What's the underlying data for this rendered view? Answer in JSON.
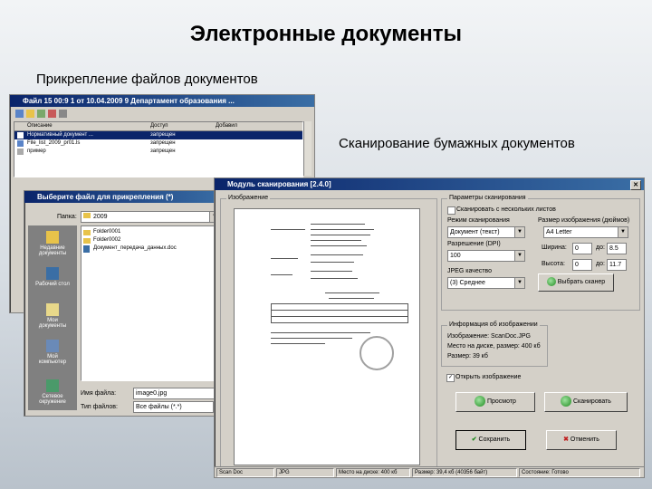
{
  "slide": {
    "title": "Электронные документы",
    "caption_attach": "Прикрепление файлов документов",
    "caption_scan": "Сканирование бумажных документов"
  },
  "main_window": {
    "title": "Файл 15 00:9 1 от 10.04.2009 9 Департамент образования ...",
    "columns": [
      "Описание",
      "Доступ",
      "Добавил"
    ],
    "rows": [
      {
        "desc": "Нормативный документ ...",
        "access": "запрещен"
      },
      {
        "desc": "File_list_2009_pr01.ls",
        "access": "запрещен"
      },
      {
        "desc": "пример",
        "access": "запрещен"
      }
    ]
  },
  "open_dialog": {
    "title": "Выберите файл для прикрепления (*)",
    "lookin_label": "Папка:",
    "lookin_value": "2009",
    "files": [
      "Folder0001",
      "Folder0002",
      "Документ_передача_данных.doc"
    ],
    "places": [
      "Недавние документы",
      "Рабочий стол",
      "Мои документы",
      "Мой компьютер",
      "Сетевое окружение"
    ],
    "filename_label": "Имя файла:",
    "filename_value": "image0.jpg",
    "filetype_label": "Тип файлов:",
    "filetype_value": "Все файлы (*.*)"
  },
  "scan_window": {
    "title": "Модуль сканирования [2.4.0]",
    "image_group": "Изображение",
    "scan_params_group": "Параметры сканирования",
    "multi_page_checkbox": "Сканировать с нескольких листов",
    "mode_label": "Режим сканирования",
    "mode_value": "Документ (текст)",
    "size_label": "Размер изображения (дюймов)",
    "size_value": "A4 Letter",
    "resolution_label": "Разрешение (DPI)",
    "resolution_value": "100",
    "width_label": "Ширина:",
    "width_value": "0",
    "height_label": "Высота:",
    "height_value": "0",
    "to_label": "до:",
    "to_width_value": "8.5",
    "to_height_value": "11.7",
    "jpeg_label": "JPEG качество",
    "jpeg_value": "(3) Среднее",
    "choose_scanner_btn": "Выбрать сканер",
    "info_group": "Информация об изображении",
    "info_line1": "Изображение: ScanDoc.JPG",
    "info_line2": "Место на диске, размер: 400 кб",
    "info_line3": "Размер: 39 кб",
    "view_checkbox": "Открыть изображение",
    "preview_btn": "Просмотр",
    "scan_btn": "Сканировать",
    "save_btn": "Сохранить",
    "cancel_btn": "Отменить",
    "status": [
      "Scan Doc",
      "JPG",
      "Место на диске: 400 кб",
      "Размер: 39,4 кб (40356 байт)",
      "Состояние: Готово"
    ]
  }
}
